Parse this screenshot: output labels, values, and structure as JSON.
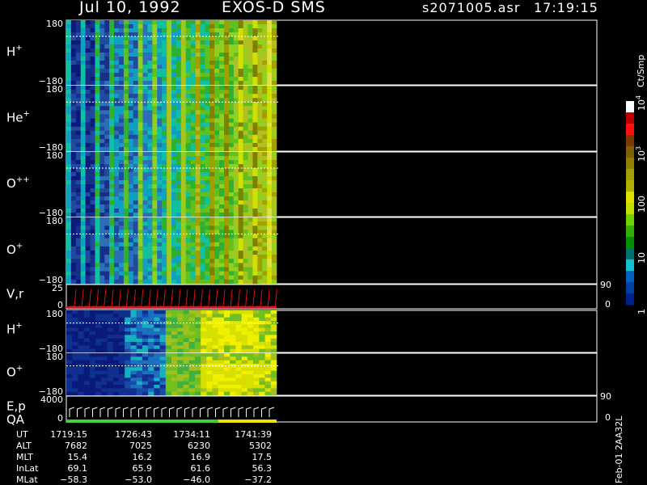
{
  "header": {
    "date": "Jul 10, 1992",
    "instrument": "EXOS-D SMS",
    "file": "s2071005.asr",
    "time": "17:19:15"
  },
  "colorbar": {
    "unit": "Ct/Smp",
    "ticks": [
      "10",
      "10",
      "100",
      "10",
      "1"
    ],
    "exponents": [
      "4",
      "3",
      "",
      "",
      ""
    ],
    "tick_values": [
      10000,
      1000,
      100,
      10,
      1
    ],
    "colors": [
      "#ffffff",
      "#c00000",
      "#ff1010",
      "#7a3a00",
      "#806000",
      "#908000",
      "#a0a000",
      "#b0b000",
      "#e0e000",
      "#c0e000",
      "#70d000",
      "#30b000",
      "#009000",
      "#007070",
      "#10c0d0",
      "#0060c0",
      "#0040a0",
      "#002090"
    ]
  },
  "panels": [
    {
      "label": "H",
      "sup": "+",
      "ymax": "180",
      "ymin": "−180",
      "mode": "sms1"
    },
    {
      "label": "He",
      "sup": "+",
      "ymax": "180",
      "ymin": "−180",
      "mode": "sms1"
    },
    {
      "label": "O",
      "sup": "++",
      "ymax": "180",
      "ymin": "−180",
      "mode": "sms1"
    },
    {
      "label": "O",
      "sup": "+",
      "ymax": "180",
      "ymin": "−180",
      "mode": "sms1"
    },
    {
      "label": "V,r",
      "sup": "",
      "ymax": "25",
      "ymin": "0",
      "right_top": "90",
      "right_bottom": "0",
      "mode": "vr"
    },
    {
      "label": "H",
      "sup": "+",
      "ymax": "180",
      "ymin": "−180",
      "mode": "sms2"
    },
    {
      "label": "O",
      "sup": "+",
      "ymax": "180",
      "ymin": "−180",
      "mode": "sms2"
    },
    {
      "label": "E,p",
      "label2": "QA",
      "ymax": "4000",
      "ymin": "0",
      "right_top": "90",
      "right_bottom": "0",
      "mode": "ep"
    }
  ],
  "ephemeris": {
    "rows": [
      {
        "name": "UT",
        "values": [
          "1719:15",
          "1726:43",
          "1734:11",
          "1741:39"
        ]
      },
      {
        "name": "ALT",
        "values": [
          "7682",
          "7025",
          "6230",
          "5302"
        ]
      },
      {
        "name": "MLT",
        "values": [
          "15.4",
          "16.2",
          "16.9",
          "17.5"
        ]
      },
      {
        "name": "InLat",
        "values": [
          "69.1",
          "65.9",
          "61.6",
          "56.3"
        ]
      },
      {
        "name": "MLat",
        "values": [
          "−58.3",
          "−53.0",
          "−46.0",
          "−37.2"
        ]
      }
    ]
  },
  "side_note": "Feb-01 2AA32L",
  "chart_data": {
    "type": "heatmap",
    "title": "Jul 10, 1992   EXOS-D SMS",
    "x_tick_labels_UT": [
      "1719:15",
      "1726:43",
      "1734:11",
      "1741:39"
    ],
    "data_extent_fraction_of_axis": 0.39,
    "y_range_pitch_angle": [
      -180,
      180
    ],
    "color_scale": "log",
    "color_range_ct_per_smp": [
      1,
      10000
    ],
    "series": [
      {
        "name": "H+"
      },
      {
        "name": "He+"
      },
      {
        "name": "O++"
      },
      {
        "name": "O+"
      },
      {
        "name": "V,r"
      },
      {
        "name": "H+"
      },
      {
        "name": "O+"
      },
      {
        "name": "E,p"
      }
    ]
  }
}
